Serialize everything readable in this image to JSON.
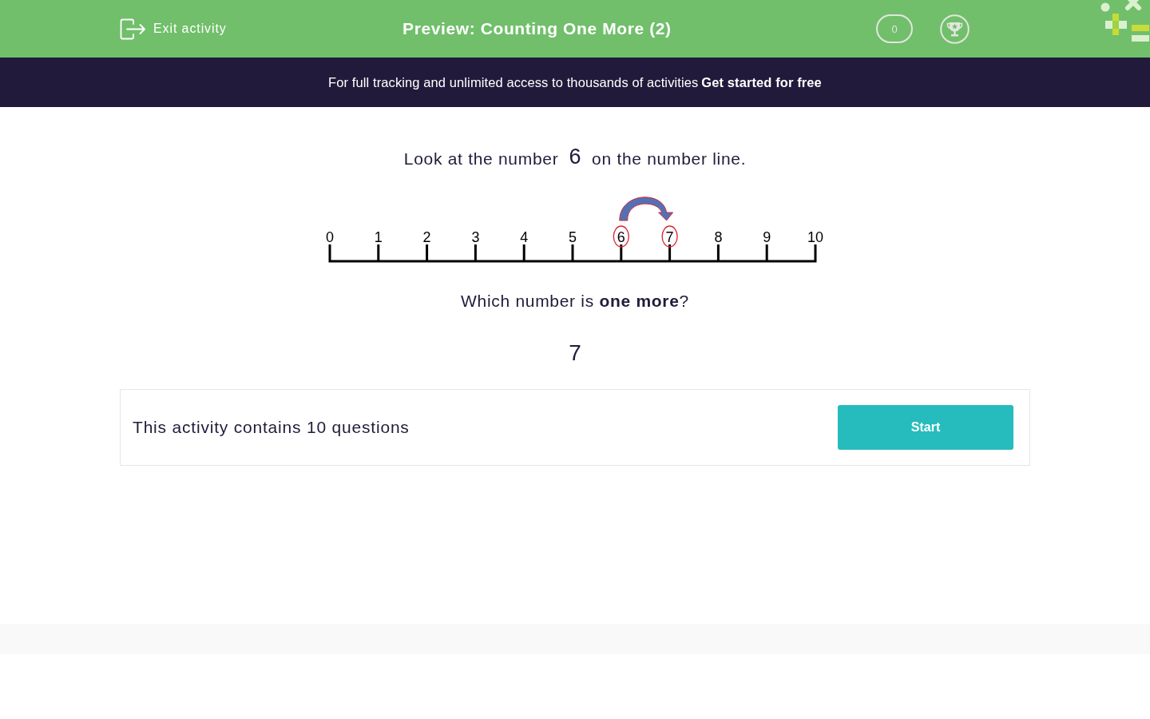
{
  "header": {
    "exit_label": "Exit activity",
    "title": "Preview: Counting One More (2)",
    "score": "0"
  },
  "banner": {
    "text": "For full tracking and unlimited access to thousands of activities",
    "link": "Get started for free"
  },
  "question": {
    "prompt_start": "Look at the number",
    "prompt_number": "6",
    "prompt_end": "on the number line.",
    "number_line": {
      "ticks": [
        {
          "label": "0",
          "circled": false
        },
        {
          "label": "1",
          "circled": false
        },
        {
          "label": "2",
          "circled": false
        },
        {
          "label": "3",
          "circled": false
        },
        {
          "label": "4",
          "circled": false
        },
        {
          "label": "5",
          "circled": false
        },
        {
          "label": "6",
          "circled": true
        },
        {
          "label": "7",
          "circled": true
        },
        {
          "label": "8",
          "circled": false
        },
        {
          "label": "9",
          "circled": false
        },
        {
          "label": "10",
          "circled": false
        }
      ]
    },
    "ask": "Which number is **one more**?",
    "answer": "7"
  },
  "activity_card": {
    "text": "This activity contains 10 questions",
    "button": "Start"
  }
}
